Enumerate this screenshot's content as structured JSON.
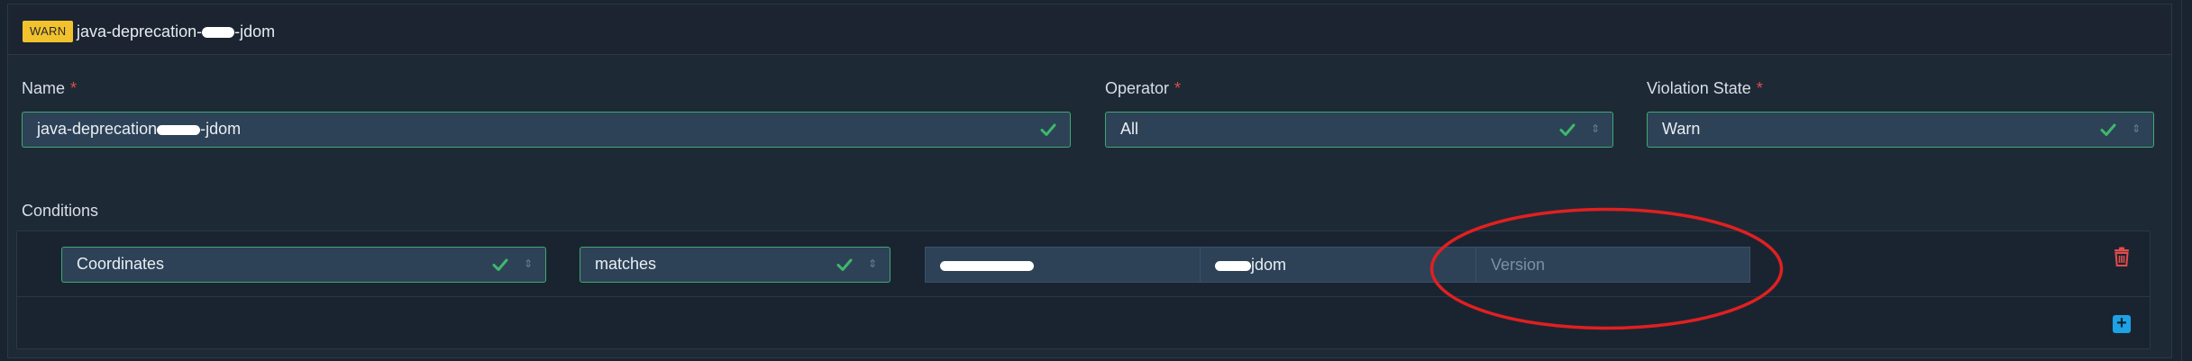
{
  "policy": {
    "badge": "WARN",
    "title": "java-deprecation-[redacted]-jdom"
  },
  "fields": {
    "name": {
      "label": "Name",
      "required_marker": "*",
      "value": "java-deprecation[redacted]-jdom"
    },
    "operator": {
      "label": "Operator",
      "required_marker": "*",
      "value": "All"
    },
    "violation_state": {
      "label": "Violation State",
      "required_marker": "*",
      "value": "Warn"
    }
  },
  "conditions": {
    "title": "Conditions",
    "rows": [
      {
        "subject": "Coordinates",
        "operator": "matches",
        "group_value": "[redacted]",
        "name_value": "[redacted]jdom",
        "version_placeholder": "Version"
      }
    ]
  },
  "colors": {
    "badge_warn": "#f2c12e",
    "valid_border": "#3fa970",
    "check_green": "#3fb86d",
    "delete_red": "#e34b4b",
    "add_blue": "#1ea2e6",
    "annotation_red": "#e02020"
  },
  "icons": {
    "check": "check-icon",
    "caret": "sort-caret-icon",
    "delete": "trash-icon",
    "add": "plus-square-icon"
  }
}
